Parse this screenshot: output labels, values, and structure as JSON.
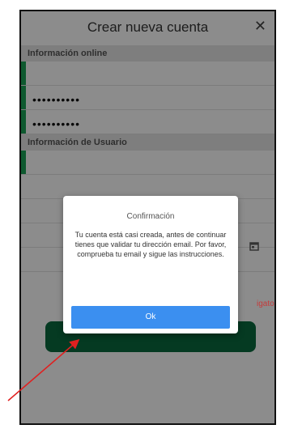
{
  "header": {
    "title": "Crear nueva cuenta",
    "close_label": "✕"
  },
  "sections": {
    "online": "Información online",
    "usuario": "Información de Usuario"
  },
  "fields": {
    "password": "••••••••••",
    "password_confirm": "••••••••••"
  },
  "background": {
    "obligatorio_fragment": "igatorio"
  },
  "dialog": {
    "title": "Confirmación",
    "message": "Tu cuenta está casi creada, antes de continuar tienes que validar tu dirección email. Por favor, comprueba tu email y sigue las instrucciones.",
    "ok_label": "Ok"
  },
  "colors": {
    "accent_green": "#1aa356",
    "ok_blue": "#3b8ff0",
    "arrow_red": "#e02020",
    "error_red": "#c53a3a"
  },
  "icons": {
    "close": "close-icon",
    "calendar": "calendar-icon"
  }
}
